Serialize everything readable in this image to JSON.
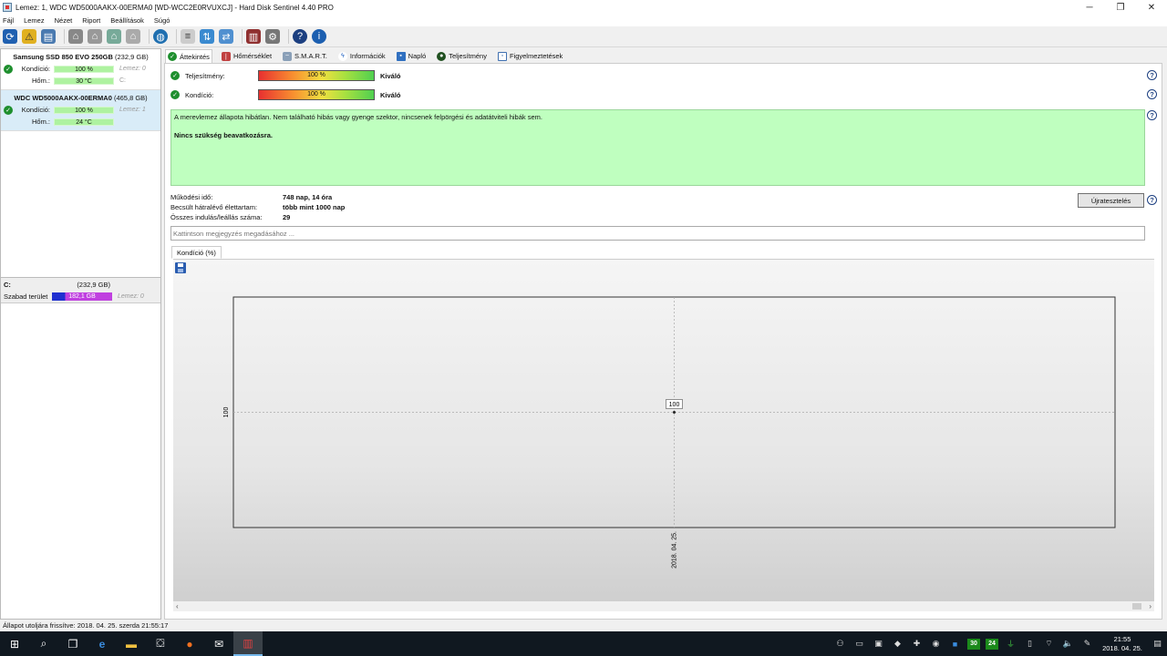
{
  "window": {
    "title": "Lemez: 1, WDC WD5000AAKX-00ERMA0 [WD-WCC2E0RVUXCJ]  -  Hard Disk Sentinel 4.40 PRO",
    "min": "─",
    "max": "❐",
    "close": "✕"
  },
  "menu": [
    {
      "label": "Fájl"
    },
    {
      "label": "Lemez"
    },
    {
      "label": "Nézet"
    },
    {
      "label": "Riport"
    },
    {
      "label": "Beállítások"
    },
    {
      "label": "Súgó"
    }
  ],
  "disks": [
    {
      "name": "Samsung SSD 850 EVO 250GB",
      "capacity": "(232,9 GB)",
      "rows": [
        {
          "label": "Kondíció:",
          "value": "100 %",
          "level": 100,
          "right": "Lemez: 0",
          "check": true
        },
        {
          "label": "Hőm.:",
          "value": "30 °C",
          "level": 100,
          "right": "C:",
          "check": false
        }
      ]
    },
    {
      "name": "WDC WD5000AAKX-00ERMA0",
      "capacity": "(465,8 GB)",
      "rows": [
        {
          "label": "Kondíció:",
          "value": "100 %",
          "level": 100,
          "right": "Lemez: 1",
          "check": true
        },
        {
          "label": "Hőm.:",
          "value": "24 °C",
          "level": 100,
          "right": "",
          "check": false
        }
      ]
    }
  ],
  "partition": {
    "drive": "C:",
    "capacity": "(232,9 GB)",
    "free_label": "Szabad terület",
    "free_value": "182,1 GB",
    "disk": "Lemez: 0"
  },
  "tabs": [
    {
      "label": "Áttekintés",
      "icon": "check-icon",
      "color": "#1e8f2e"
    },
    {
      "label": "Hőmérséklet",
      "icon": "thermometer-icon",
      "color": "#c04040"
    },
    {
      "label": "S.M.A.R.T.",
      "icon": "smart-icon",
      "color": "#6080a0"
    },
    {
      "label": "Információk",
      "icon": "info-icon",
      "color": "#2060c0"
    },
    {
      "label": "Napló",
      "icon": "log-icon",
      "color": "#3070c0"
    },
    {
      "label": "Teljesítmény",
      "icon": "performance-icon",
      "color": "#205020"
    },
    {
      "label": "Figyelmeztetések",
      "icon": "alert-icon",
      "color": "#4070b0"
    }
  ],
  "overview": {
    "performance": {
      "label": "Teljesítmény:",
      "value": "100 %",
      "rating": "Kiváló"
    },
    "health": {
      "label": "Kondíció:",
      "value": "100 %",
      "rating": "Kiváló"
    },
    "message_line1": "A merevlemez állapota hibátlan. Nem található hibás vagy gyenge szektor, nincsenek felpörgési és adatátviteli hibák sem.",
    "message_line2": "Nincs szükség beavatkozásra.",
    "stats": [
      {
        "k": "Működési idő:",
        "v": "748 nap, 14 óra"
      },
      {
        "k": "Becsült hátralévő élettartam:",
        "v": "több mint 1000 nap"
      },
      {
        "k": "Összes indulás/leállás száma:",
        "v": "29"
      }
    ],
    "retest_label": "Újratesztelés",
    "note_placeholder": "Kattintson megjegyzés megadásához ...",
    "chart_tab": "Kondíció  (%)"
  },
  "chart_data": {
    "type": "line",
    "title": "",
    "x": [
      "2018. 04. 25."
    ],
    "series": [
      {
        "values": [
          100
        ]
      }
    ],
    "xlabel": "",
    "ylabel": "",
    "y_tick_labels": [
      "100"
    ],
    "x_tick_labels": [
      "2018. 04. 25."
    ],
    "data_labels": [
      "100"
    ],
    "ylim": [
      99,
      101
    ],
    "grid": true,
    "legend": "none"
  },
  "statusbar": {
    "text": "Állapot utoljára frissítve: 2018. 04. 25. szerda 21:55:17"
  },
  "taskbar": {
    "time": "21:55",
    "date": "2018. 04. 25.",
    "temp1": "30",
    "temp2": "24"
  }
}
